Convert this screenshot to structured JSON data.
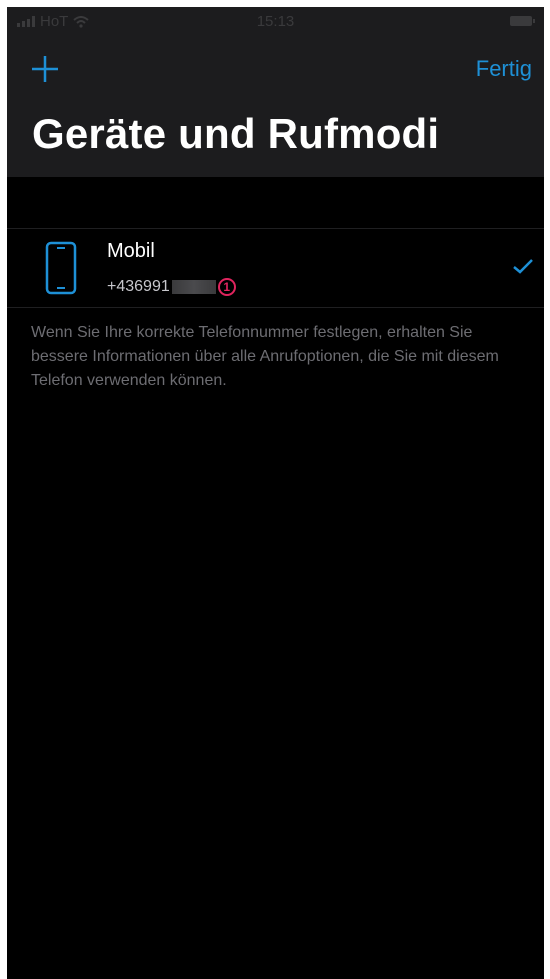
{
  "status_bar": {
    "carrier": "HoT",
    "time": "15:13"
  },
  "nav": {
    "add_icon": "plus-icon",
    "done_label": "Fertig",
    "accent_color": "#1e90d6"
  },
  "page": {
    "title": "Geräte und Rufmodi"
  },
  "devices": [
    {
      "icon": "smartphone-icon",
      "name": "Mobil",
      "number": "+436991",
      "selected": true,
      "annotation_marker": "1"
    }
  ],
  "footer": {
    "text": "Wenn Sie Ihre korrekte Telefonnummer festlegen, erhalten Sie bessere Informationen über alle Anrufoptionen, die Sie mit diesem Telefon verwenden können."
  }
}
